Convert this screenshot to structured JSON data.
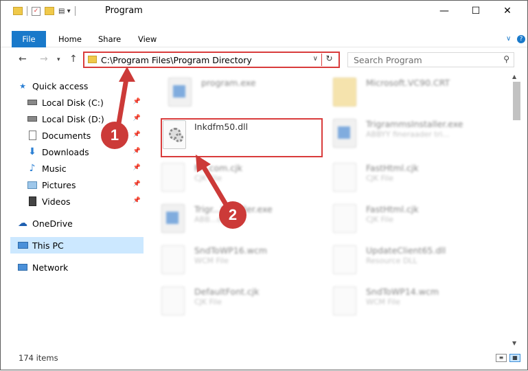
{
  "window": {
    "title": "Program",
    "minimize": "—",
    "maximize": "☐",
    "close": "✕"
  },
  "ribbon": {
    "tabs": [
      "File",
      "Home",
      "Share",
      "View"
    ]
  },
  "address": {
    "path": "C:\\Program Files\\Program Directory",
    "dropdown_icon": "chevron-down-icon",
    "refresh_icon": "refresh-icon"
  },
  "search": {
    "placeholder": "Search Program"
  },
  "sidebar": {
    "items": [
      {
        "label": "Quick access",
        "icon": "star-icon",
        "pinned": false
      },
      {
        "label": "Local Disk (C:)",
        "icon": "drive-icon",
        "pinned": true
      },
      {
        "label": "Local Disk (D:)",
        "icon": "drive-icon",
        "pinned": true
      },
      {
        "label": "Documents",
        "icon": "documents-icon",
        "pinned": true
      },
      {
        "label": "Downloads",
        "icon": "download-icon",
        "pinned": true
      },
      {
        "label": "Music",
        "icon": "music-icon",
        "pinned": true
      },
      {
        "label": "Pictures",
        "icon": "pictures-icon",
        "pinned": true
      },
      {
        "label": "Videos",
        "icon": "videos-icon",
        "pinned": true
      },
      {
        "label": "OneDrive",
        "icon": "cloud-icon",
        "pinned": false
      },
      {
        "label": "This PC",
        "icon": "computer-icon",
        "pinned": false,
        "selected": true
      },
      {
        "label": "Network",
        "icon": "network-icon",
        "pinned": false
      }
    ]
  },
  "files": [
    {
      "name": "program.exe",
      "type": "",
      "kind": "exe"
    },
    {
      "name": "Microsoft.VC90.CRT",
      "type": "",
      "kind": "folder"
    },
    {
      "name": "Inkdfm50.dll",
      "type": "",
      "kind": "dll",
      "highlighted": true
    },
    {
      "name": "TrigrammsInstaller.exe",
      "type": "ABBYY fineraader tri...",
      "kind": "exe"
    },
    {
      "name": "Fi...com.cjk",
      "type": "CJK File",
      "kind": "doc"
    },
    {
      "name": "FastHtml.cjk",
      "type": "CJK File",
      "kind": "doc"
    },
    {
      "name": "Trigr...Installer.exe",
      "type": "ABB...der tri...",
      "kind": "exe"
    },
    {
      "name": "FastHtml.cjk",
      "type": "CJK File",
      "kind": "doc"
    },
    {
      "name": "SndToWP16.wcm",
      "type": "WCM File",
      "kind": "doc"
    },
    {
      "name": "UpdateClient65.dll",
      "type": "Resource DLL",
      "kind": "dll"
    },
    {
      "name": "DefaultFont.cjk",
      "type": "CJK File",
      "kind": "doc"
    },
    {
      "name": "SndToWP14.wcm",
      "type": "WCM File",
      "kind": "doc"
    }
  ],
  "annotations": {
    "step1": "1",
    "step2": "2",
    "color": "#cc3a38"
  },
  "status": {
    "item_count": "174 items"
  },
  "colors": {
    "file_tab": "#1979ca",
    "selection": "#cce8ff",
    "highlight_border": "#d93b3b"
  }
}
